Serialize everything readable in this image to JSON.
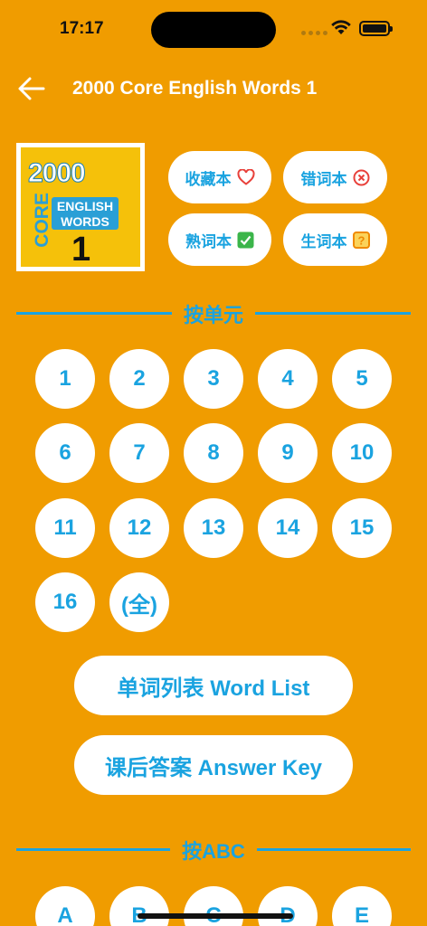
{
  "status": {
    "time": "17:17"
  },
  "nav": {
    "title": "2000 Core English Words 1"
  },
  "cover": {
    "line1": "2000",
    "line2": "CORE",
    "line3a": "ENGLISH",
    "line3b": "WORDS",
    "number": "1"
  },
  "collections": [
    {
      "label": "收藏本",
      "icon": "heart-icon"
    },
    {
      "label": "错词本",
      "icon": "x-circle-icon"
    },
    {
      "label": "熟词本",
      "icon": "check-box-icon"
    },
    {
      "label": "生词本",
      "icon": "question-box-icon"
    }
  ],
  "units_section": {
    "label": "按单元"
  },
  "units": [
    "1",
    "2",
    "3",
    "4",
    "5",
    "6",
    "7",
    "8",
    "9",
    "10",
    "11",
    "12",
    "13",
    "14",
    "15",
    "16",
    "(全)"
  ],
  "word_list_button": "单词列表 Word List",
  "answer_key_button": "课后答案 Answer Key",
  "abc_section": {
    "label": "按ABC"
  },
  "letters": [
    "A",
    "B",
    "C",
    "D",
    "E"
  ],
  "colors": {
    "background": "#F09C00",
    "accent": "#1AA3E0",
    "white": "#FFFFFF"
  }
}
